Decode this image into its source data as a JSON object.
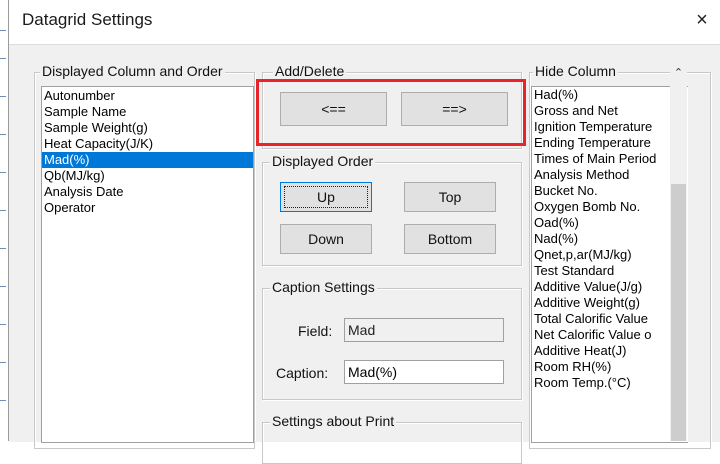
{
  "window": {
    "title": "Datagrid Settings",
    "close_glyph": "×",
    "accent": "#0078d7"
  },
  "displayed": {
    "legend": "Displayed Column and Order",
    "items": [
      "Autonumber",
      "Sample Name",
      "Sample Weight(g)",
      "Heat Capacity(J/K)",
      "Mad(%)",
      "Qb(MJ/kg)",
      "Analysis Date",
      "Operator"
    ],
    "selected": "Mad(%)"
  },
  "add_delete": {
    "legend": "Add/Delete",
    "add_label": "<==",
    "remove_label": "==>"
  },
  "order": {
    "legend": "Displayed Order",
    "up": "Up",
    "top": "Top",
    "down": "Down",
    "bottom": "Bottom"
  },
  "caption": {
    "legend": "Caption Settings",
    "field_label": "Field:",
    "field_value": "Mad",
    "caption_label": "Caption:",
    "caption_value": "Mad(%)"
  },
  "print": {
    "legend": "Settings about Print"
  },
  "hidden": {
    "legend": "Hide Column",
    "items": [
      "Had(%)",
      "Gross and Net",
      "Ignition Temperature",
      "Ending Temperature",
      "Times of Main Period",
      "Analysis Method",
      "Bucket No.",
      "Oxygen Bomb No.",
      "Oad(%)",
      "Nad(%)",
      "Qnet,p,ar(MJ/kg)",
      "Test Standard",
      "Additive Value(J/g)",
      "Additive Weight(g)",
      "Total Calorific Value",
      "Net Calorific Value o",
      "Additive Heat(J)",
      "Room RH(%)",
      "Room Temp.(°C)"
    ]
  },
  "annotation": {
    "highlight_color": "#e8232a"
  }
}
